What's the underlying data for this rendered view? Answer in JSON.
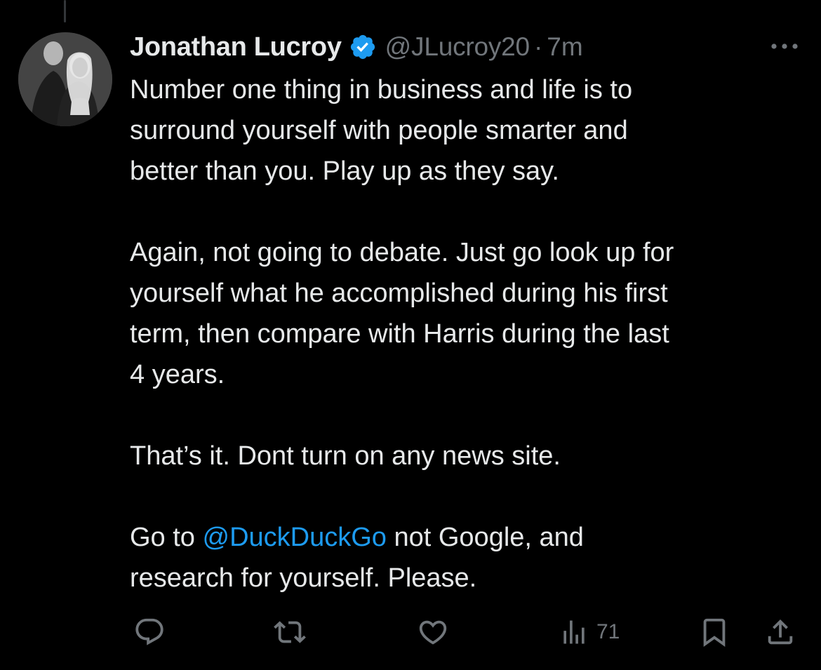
{
  "tweet": {
    "author": {
      "display_name": "Jonathan Lucroy",
      "handle": "@JLucroy20",
      "verified": true
    },
    "separator": "·",
    "time": "7m",
    "body": {
      "para1": [
        "Number one thing in business and life is to",
        "surround yourself with people smarter and",
        "better than you. Play up as they say."
      ],
      "para2": [
        "Again, not going to debate. Just go look up for",
        "yourself what he accomplished during his first",
        "term, then compare with Harris during the last",
        "4 years."
      ],
      "para3": [
        "That’s it. Dont turn on any news site."
      ],
      "para4_before": "Go to ",
      "para4_mention": "@DuckDuckGo",
      "para4_after": " not Google, and",
      "para4_line2": "research for yourself. Please."
    },
    "actions": {
      "views": "71"
    }
  },
  "colors": {
    "background": "#000000",
    "text": "#e7e9ea",
    "secondary": "#71767b",
    "accent": "#1d9bf0"
  },
  "icons": {
    "verified": "verified-badge-icon",
    "more": "more-icon",
    "reply": "reply-icon",
    "retweet": "retweet-icon",
    "like": "like-icon",
    "views": "views-icon",
    "bookmark": "bookmark-icon",
    "share": "share-icon"
  }
}
